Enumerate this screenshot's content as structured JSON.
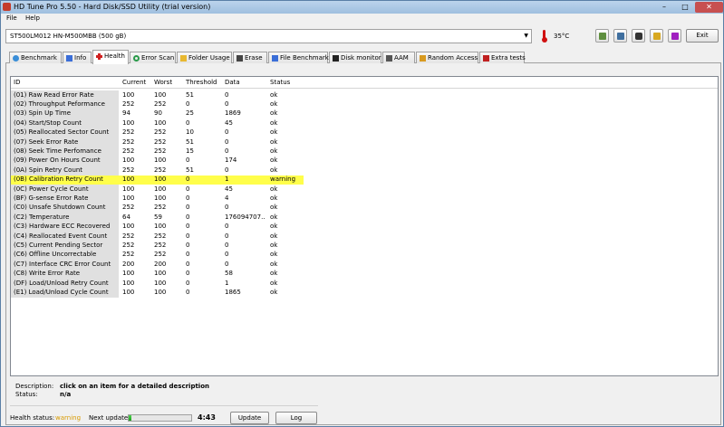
{
  "window": {
    "title": "HD Tune Pro 5.50 - Hard Disk/SSD Utility (trial version)",
    "minimize": "–",
    "maximize": "□",
    "close": "✕"
  },
  "menu": {
    "file": "File",
    "help": "Help"
  },
  "toolbar": {
    "drive": "ST500LM012 HN-M500MBB (500 gB)",
    "temperature": "35°C",
    "exit_label": "Exit",
    "icons": [
      "copy-icon",
      "copy-screen-icon",
      "screenshot-icon",
      "options-icon",
      "save-icon"
    ]
  },
  "tabs": [
    {
      "label": "Benchmark",
      "icon": "benchmark-icon",
      "color": "#3a8ed8"
    },
    {
      "label": "Info",
      "icon": "info-icon",
      "color": "#3a6ed8"
    },
    {
      "label": "Health",
      "icon": "health-icon",
      "color": "#d02020",
      "active": true
    },
    {
      "label": "Error Scan",
      "icon": "magnifier-icon",
      "color": "#2a9a4a"
    },
    {
      "label": "Folder Usage",
      "icon": "folder-icon",
      "color": "#e8b830"
    },
    {
      "label": "Erase",
      "icon": "erase-icon",
      "color": "#444444"
    },
    {
      "label": "File Benchmark",
      "icon": "file-benchmark-icon",
      "color": "#3a6ed8"
    },
    {
      "label": "Disk monitor",
      "icon": "disk-monitor-icon",
      "color": "#222222"
    },
    {
      "label": "AAM",
      "icon": "speaker-icon",
      "color": "#555555"
    },
    {
      "label": "Random Access",
      "icon": "random-access-icon",
      "color": "#d89a20"
    },
    {
      "label": "Extra tests",
      "icon": "extra-tests-icon",
      "color": "#c02020"
    }
  ],
  "table": {
    "headers": {
      "id": "ID",
      "current": "Current",
      "worst": "Worst",
      "threshold": "Threshold",
      "data": "Data",
      "status": "Status"
    },
    "rows": [
      {
        "id": "(01) Raw Read Error Rate",
        "current": "100",
        "worst": "100",
        "threshold": "51",
        "data": "0",
        "status": "ok"
      },
      {
        "id": "(02) Throughput Peformance",
        "current": "252",
        "worst": "252",
        "threshold": "0",
        "data": "0",
        "status": "ok"
      },
      {
        "id": "(03) Spin Up Time",
        "current": "94",
        "worst": "90",
        "threshold": "25",
        "data": "1869",
        "status": "ok"
      },
      {
        "id": "(04) Start/Stop Count",
        "current": "100",
        "worst": "100",
        "threshold": "0",
        "data": "45",
        "status": "ok"
      },
      {
        "id": "(05) Reallocated Sector Count",
        "current": "252",
        "worst": "252",
        "threshold": "10",
        "data": "0",
        "status": "ok"
      },
      {
        "id": "(07) Seek Error Rate",
        "current": "252",
        "worst": "252",
        "threshold": "51",
        "data": "0",
        "status": "ok"
      },
      {
        "id": "(08) Seek Time Perfomance",
        "current": "252",
        "worst": "252",
        "threshold": "15",
        "data": "0",
        "status": "ok"
      },
      {
        "id": "(09) Power On Hours Count",
        "current": "100",
        "worst": "100",
        "threshold": "0",
        "data": "174",
        "status": "ok"
      },
      {
        "id": "(0A) Spin Retry Count",
        "current": "252",
        "worst": "252",
        "threshold": "51",
        "data": "0",
        "status": "ok"
      },
      {
        "id": "(0B) Calibration Retry Count",
        "current": "100",
        "worst": "100",
        "threshold": "0",
        "data": "1",
        "status": "warning",
        "warn": true
      },
      {
        "id": "(0C) Power Cycle Count",
        "current": "100",
        "worst": "100",
        "threshold": "0",
        "data": "45",
        "status": "ok"
      },
      {
        "id": "(BF) G-sense Error Rate",
        "current": "100",
        "worst": "100",
        "threshold": "0",
        "data": "4",
        "status": "ok"
      },
      {
        "id": "(C0) Unsafe Shutdown Count",
        "current": "252",
        "worst": "252",
        "threshold": "0",
        "data": "0",
        "status": "ok"
      },
      {
        "id": "(C2) Temperature",
        "current": "64",
        "worst": "59",
        "threshold": "0",
        "data": "176094707...",
        "status": "ok"
      },
      {
        "id": "(C3) Hardware ECC Recovered",
        "current": "100",
        "worst": "100",
        "threshold": "0",
        "data": "0",
        "status": "ok"
      },
      {
        "id": "(C4) Reallocated Event Count",
        "current": "252",
        "worst": "252",
        "threshold": "0",
        "data": "0",
        "status": "ok"
      },
      {
        "id": "(C5) Current Pending Sector",
        "current": "252",
        "worst": "252",
        "threshold": "0",
        "data": "0",
        "status": "ok"
      },
      {
        "id": "(C6) Offline Uncorrectable",
        "current": "252",
        "worst": "252",
        "threshold": "0",
        "data": "0",
        "status": "ok"
      },
      {
        "id": "(C7) Interface CRC Error Count",
        "current": "200",
        "worst": "200",
        "threshold": "0",
        "data": "0",
        "status": "ok"
      },
      {
        "id": "(C8) Write Error Rate",
        "current": "100",
        "worst": "100",
        "threshold": "0",
        "data": "58",
        "status": "ok"
      },
      {
        "id": "(DF) Load/Unload Retry Count",
        "current": "100",
        "worst": "100",
        "threshold": "0",
        "data": "1",
        "status": "ok"
      },
      {
        "id": "(E1) Load/Unload Cycle Count",
        "current": "100",
        "worst": "100",
        "threshold": "0",
        "data": "1865",
        "status": "ok"
      }
    ]
  },
  "description": {
    "label": "Description:",
    "value": "click on an item for a detailed description"
  },
  "status": {
    "label": "Status:",
    "value": "n/a"
  },
  "footer": {
    "health_label": "Health status:",
    "health_value": "warning",
    "health_color": "#d89a00",
    "next_update_label": "Next update:",
    "progress_fraction": 0.04,
    "time": "4:43",
    "update_label": "Update",
    "log_label": "Log"
  }
}
